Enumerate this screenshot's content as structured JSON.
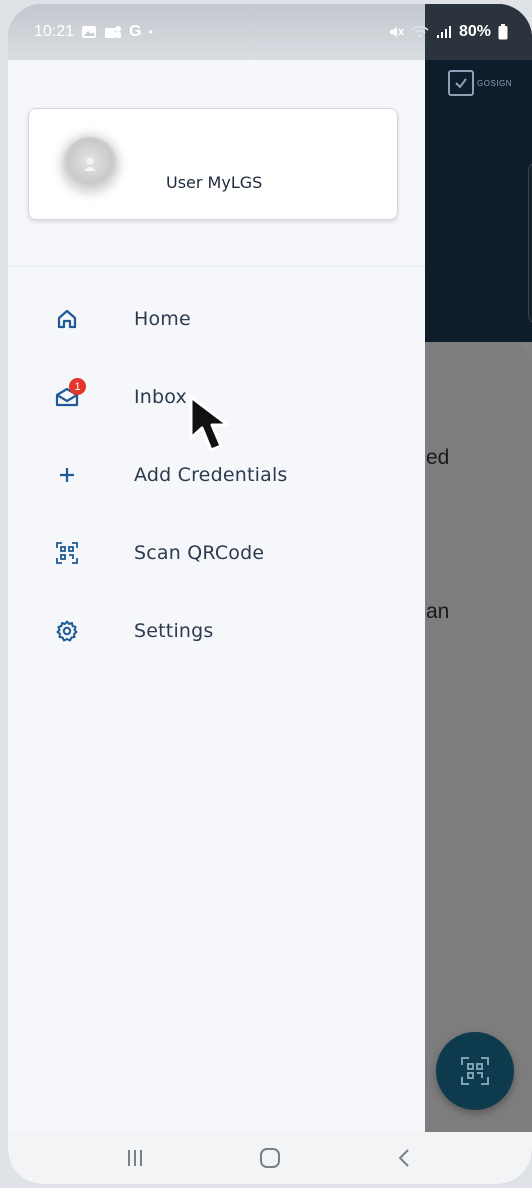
{
  "status_bar": {
    "time": "10:21",
    "carrier": "G",
    "battery": "80%"
  },
  "app": {
    "logo_text": "GOSIGN",
    "peek_texts": [
      "ed",
      "an"
    ]
  },
  "drawer": {
    "user_name": "User MyLGS",
    "menu": [
      {
        "label": "Home",
        "icon": "home-icon"
      },
      {
        "label": "Inbox",
        "icon": "mail-icon",
        "badge": "1"
      },
      {
        "label": "Add Credentials",
        "icon": "plus-icon"
      },
      {
        "label": "Scan QRCode",
        "icon": "qr-scan-icon"
      },
      {
        "label": "Settings",
        "icon": "gear-icon"
      }
    ]
  },
  "nav_bar": {
    "recent_icon": "recent-apps-icon",
    "home_icon": "home-button-icon",
    "back_icon": "back-icon"
  },
  "colors": {
    "accent": "#1f5a96",
    "badge": "#e5352b",
    "drawer_bg": "#f5f7fa",
    "header_dark": "#0f1c2c"
  }
}
